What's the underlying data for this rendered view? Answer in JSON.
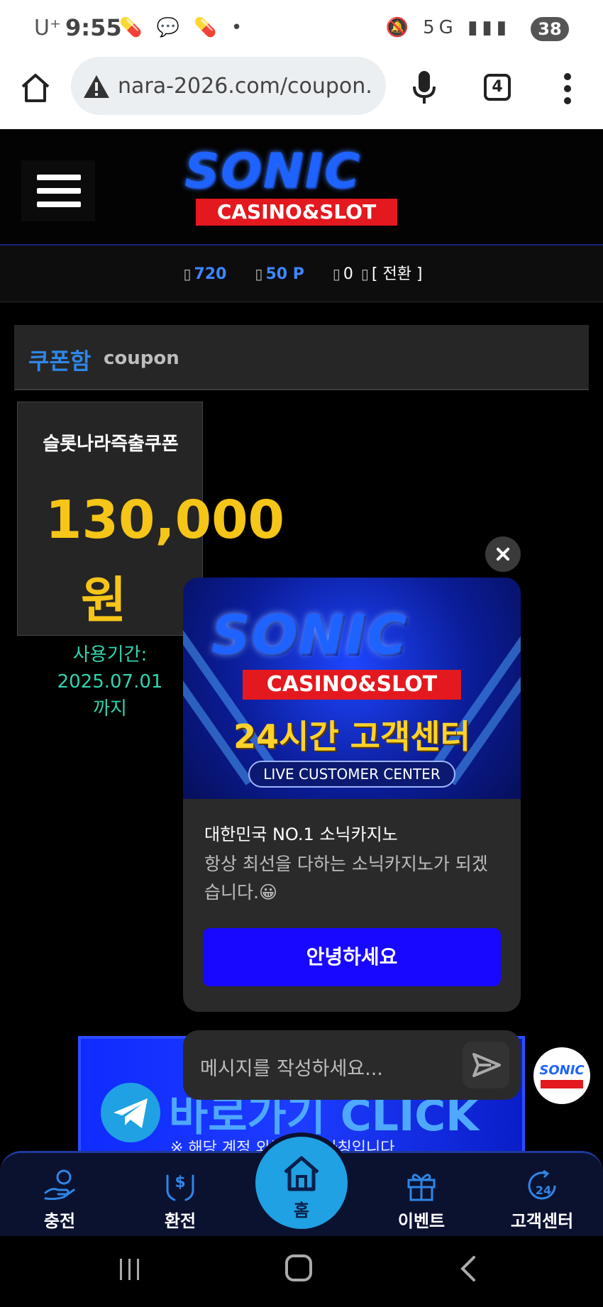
{
  "status_bar": {
    "carrier": "U⁺",
    "time": "9:55",
    "left_icons": "💊 💬 💊 •",
    "right_icons": "🔕 5G ▮▮▮",
    "battery": "38"
  },
  "browser": {
    "url": "nara-2026.com/coupon.",
    "tab_count": "4"
  },
  "site": {
    "logo_word": "SONIC",
    "logo_sub": "CASINO&SLOT",
    "balance": {
      "money": "720",
      "points": "50 P",
      "other": "0",
      "convert_label": "[ 전환 ]"
    }
  },
  "coupon_section": {
    "title_ko": "쿠폰함",
    "title_en": "coupon",
    "coupon": {
      "name": "슬롯나라즉출쿠폰",
      "amount": "130,000",
      "unit": "원",
      "period_label": "사용기간:",
      "period_date": "2025.07.01",
      "period_suffix": "까지"
    }
  },
  "telegram_banner": {
    "text": "바로가기 CLICK",
    "note": "※ 해당 계정 외는 모두 사칭입니다."
  },
  "chat": {
    "banner_logo": "SONIC",
    "banner_sub": "CASINO&SLOT",
    "banner_headline": "24시간 고객센터",
    "banner_live": "LIVE CUSTOMER CENTER",
    "title": "대한민국 NO.1 소닉카지노",
    "message": "항상 최선을 다하는 소닉카지노가 되겠습니다.😀",
    "greet_button": "안녕하세요",
    "input_placeholder": "메시지를 작성하세요...",
    "bubble_word": "SONIC"
  },
  "bottom_nav": {
    "items": [
      {
        "label": "충전",
        "icon": "deposit-hand-icon"
      },
      {
        "label": "환전",
        "icon": "exchange-money-icon"
      },
      {
        "label": "홈",
        "icon": "home-icon"
      },
      {
        "label": "이벤트",
        "icon": "gift-icon"
      },
      {
        "label": "고객센터",
        "icon": "support-24-icon"
      }
    ]
  },
  "colors": {
    "accent_blue": "#2f86e6",
    "coupon_gold": "#f5c518",
    "period_teal": "#32d3b0",
    "greet_button": "#1808ff",
    "home_circle": "#1fa1e3"
  }
}
